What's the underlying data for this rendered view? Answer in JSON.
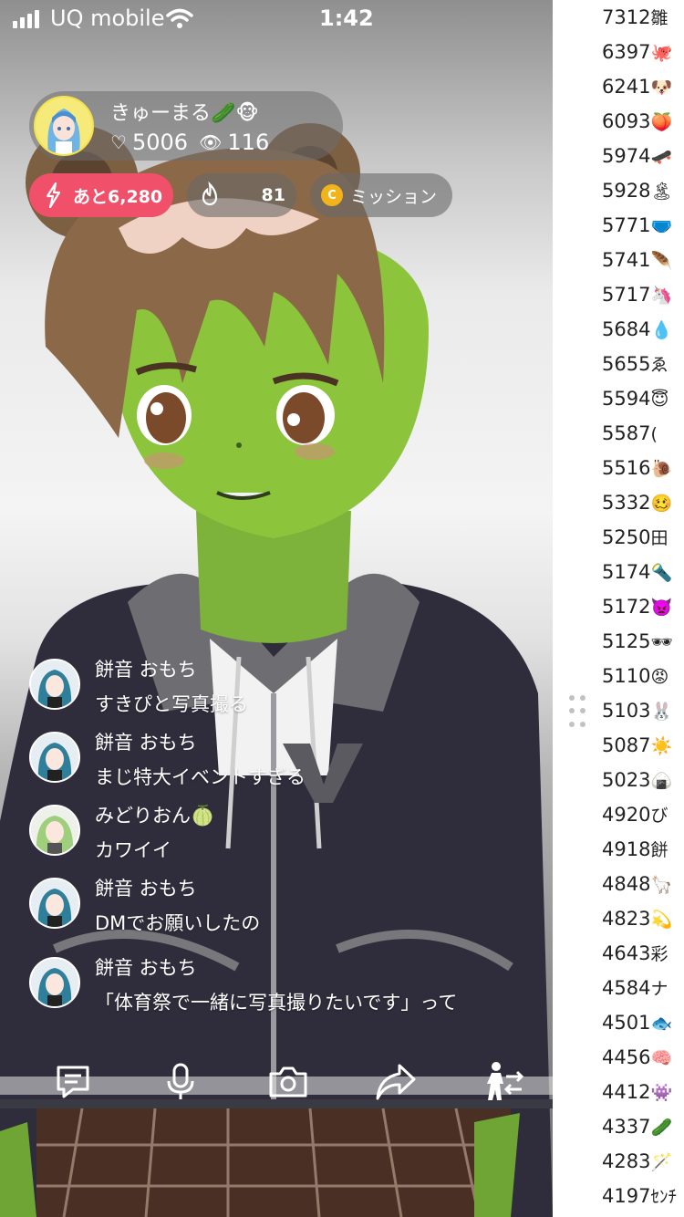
{
  "status_bar": {
    "carrier": "UQ mobile",
    "time": "1:42"
  },
  "streamer": {
    "name": "きゅーまる🥒🐵",
    "hearts": "5006",
    "viewers": "116"
  },
  "pills": {
    "goal": "あと6,280",
    "fire_count": "81",
    "coin_letter": "C",
    "mission": "ミッション"
  },
  "comments": [
    {
      "user": "餅音 おもち",
      "text": "すきぴと写真撮る",
      "avatar": "blue"
    },
    {
      "user": "餅音 おもち",
      "text": "まじ特大イベントすぎる",
      "avatar": "blue"
    },
    {
      "user": "みどりおん🍈",
      "text": "カワイイ",
      "avatar": "green"
    },
    {
      "user": "餅音 おもち",
      "text": "DMでお願いしたの",
      "avatar": "blue"
    },
    {
      "user": "餅音 おもち",
      "text": "「体育祭で一緒に写真撮りたいです」って",
      "avatar": "blue"
    }
  ],
  "toolbar": {
    "icons": [
      "comment-icon",
      "microphone-icon",
      "camera-icon",
      "share-icon",
      "collab-icon",
      "more-icon"
    ]
  },
  "ranking": [
    {
      "score": "7312",
      "emoji": "雛"
    },
    {
      "score": "6397",
      "emoji": "🐙"
    },
    {
      "score": "6241",
      "emoji": "🐶"
    },
    {
      "score": "6093",
      "emoji": "🍑"
    },
    {
      "score": "5974",
      "emoji": "🛹"
    },
    {
      "score": "5928",
      "emoji": "🏝"
    },
    {
      "score": "5771",
      "emoji": "🩲"
    },
    {
      "score": "5741",
      "emoji": "🪶"
    },
    {
      "score": "5717",
      "emoji": "🦄"
    },
    {
      "score": "5684",
      "emoji": "💧"
    },
    {
      "score": "5655",
      "emoji": "ゑ"
    },
    {
      "score": "5594",
      "emoji": "😇"
    },
    {
      "score": "5587",
      "emoji": "("
    },
    {
      "score": "5516",
      "emoji": "🐌"
    },
    {
      "score": "5332",
      "emoji": "🥴"
    },
    {
      "score": "5250",
      "emoji": "田"
    },
    {
      "score": "5174",
      "emoji": "🔦"
    },
    {
      "score": "5172",
      "emoji": "👿"
    },
    {
      "score": "5125",
      "emoji": "🕶"
    },
    {
      "score": "5110",
      "emoji": "😡"
    },
    {
      "score": "5103",
      "emoji": "🐰"
    },
    {
      "score": "5087",
      "emoji": "☀️"
    },
    {
      "score": "5023",
      "emoji": "🍙"
    },
    {
      "score": "4920",
      "emoji": "び"
    },
    {
      "score": "4918",
      "emoji": "餅"
    },
    {
      "score": "4848",
      "emoji": "🦙"
    },
    {
      "score": "4823",
      "emoji": "💫"
    },
    {
      "score": "4643",
      "emoji": "彩"
    },
    {
      "score": "4584",
      "emoji": "ナ"
    },
    {
      "score": "4501",
      "emoji": "🐟"
    },
    {
      "score": "4456",
      "emoji": "🧠"
    },
    {
      "score": "4412",
      "emoji": "👾"
    },
    {
      "score": "4337",
      "emoji": "🥒"
    },
    {
      "score": "4283",
      "emoji": "🪄"
    },
    {
      "score": "4197",
      "emoji": "ｾﾝﾁ"
    }
  ],
  "colors": {
    "goal_pill": "#f0506a",
    "coin": "#f2b41b",
    "skin": "#8cc43c",
    "hoodie": "#2f2d3b",
    "hair": "#8a6848"
  }
}
